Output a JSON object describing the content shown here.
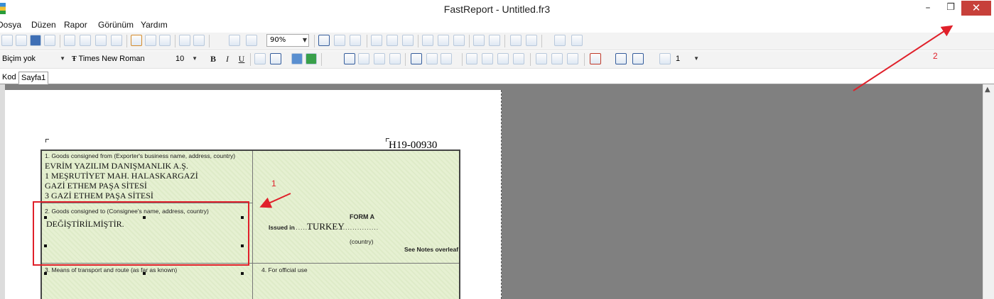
{
  "window": {
    "title": "FastReport - Untitled.fr3",
    "minimize_glyph": "–",
    "restore_glyph": "❐",
    "close_glyph": "✕"
  },
  "menu": {
    "items": [
      "Dosya",
      "Düzen",
      "Rapor",
      "Görünüm",
      "Yardım"
    ]
  },
  "toolbar": {
    "zoom_value": "90%"
  },
  "format_toolbar": {
    "style_value": "Biçim yok",
    "font_value": "Times New Roman",
    "size_value": "10",
    "bold_label": "B",
    "italic_label": "I",
    "underline_label": "U",
    "line_width_value": "1"
  },
  "tabs": [
    {
      "label": "Kod"
    },
    {
      "label": "Sayfa1"
    }
  ],
  "report": {
    "certificate_number": "H19-00930",
    "box1_label": "1. Goods consigned from (Exporter's business name, address, country)",
    "exporter_lines": [
      "EVRİM YAZILIM DANIŞMANLIK A.Ş.",
      "1 MEŞRUTİYET MAH. HALASKARGAZİ",
      "GAZİ ETHEM PAŞA SİTESİ",
      "3 GAZİ ETHEM PAŞA SİTESİ"
    ],
    "box2_label": "2. Goods consigned to (Consignee's name, address, country)",
    "consignee_value": "DEĞİŞTİRİLMİŞTİR.",
    "box3_label": "3. Means of transport and route (as far as known)",
    "box4_label": "4. For official use",
    "form_title": "FORM A",
    "issued_in_label": "Issued in",
    "issued_in_value": "TURKEY",
    "country_label": "(country)",
    "see_notes": "See Notes overleaf"
  },
  "annotations": {
    "label_1": "1",
    "label_2": "2",
    "color": "#e0202a"
  },
  "icons": [
    "app-icon",
    "new-icon",
    "open-icon",
    "save-icon",
    "preview-icon",
    "cut-icon",
    "copy-icon",
    "paste-icon",
    "undo-icon",
    "redo-icon",
    "grid-icon",
    "align-left-icon",
    "align-center-icon",
    "align-right-icon",
    "justify-icon",
    "fill-color-icon",
    "frame-color-icon",
    "scroll-up-icon"
  ]
}
